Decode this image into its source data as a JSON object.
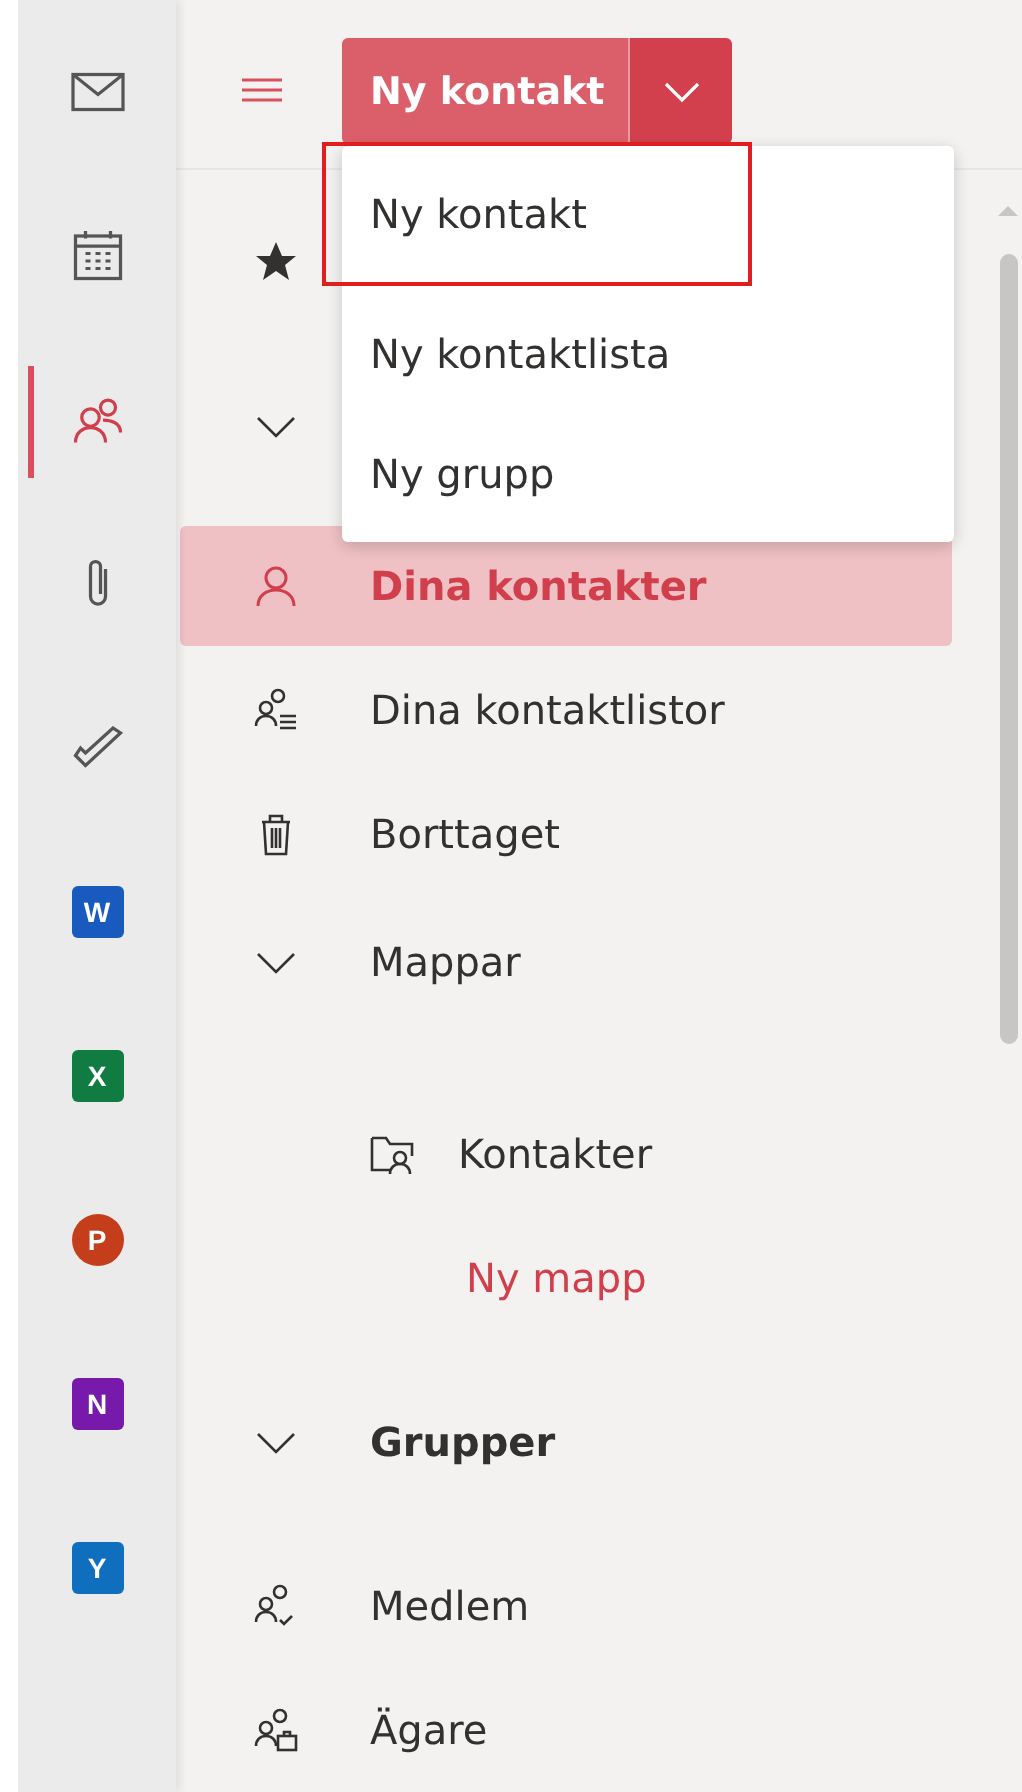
{
  "app_rail": [
    {
      "kind": "mail",
      "selected": false
    },
    {
      "kind": "calendar",
      "selected": false
    },
    {
      "kind": "people",
      "selected": true
    },
    {
      "kind": "files",
      "selected": false
    },
    {
      "kind": "todo",
      "selected": false
    },
    {
      "kind": "app",
      "letter": "W",
      "color": "#185abd",
      "selected": false
    },
    {
      "kind": "app",
      "letter": "X",
      "color": "#107c41",
      "selected": false
    },
    {
      "kind": "app-round",
      "letter": "P",
      "color": "#c43e1c",
      "selected": false
    },
    {
      "kind": "app",
      "letter": "N",
      "color": "#7719aa",
      "selected": false
    },
    {
      "kind": "app",
      "letter": "Y",
      "color": "#106ebe",
      "selected": false
    }
  ],
  "toolbar": {
    "new_button": {
      "label": "Ny kontakt"
    }
  },
  "new_menu": {
    "items": [
      {
        "label": "Ny kontakt",
        "highlighted": true
      },
      {
        "label": "Ny kontaktlista",
        "highlighted": false
      },
      {
        "label": "Ny grupp",
        "highlighted": false
      }
    ]
  },
  "nav": [
    {
      "kind": "favorites",
      "selected": false
    },
    {
      "kind": "section",
      "expanded": true
    },
    {
      "kind": "item",
      "label": "Dina kontakter",
      "selected": true
    },
    {
      "kind": "item",
      "label": "Dina kontaktlistor",
      "selected": false
    },
    {
      "kind": "item",
      "label": "Borttaget",
      "selected": false
    },
    {
      "kind": "section",
      "expanded": true,
      "label": "Mappar"
    },
    {
      "kind": "subitem",
      "label": "Kontakter",
      "selected": false
    },
    {
      "kind": "link",
      "label": "Ny mapp"
    },
    {
      "kind": "group",
      "expanded": true,
      "label": "Grupper"
    },
    {
      "kind": "item",
      "label": "Medlem",
      "selected": false
    },
    {
      "kind": "item",
      "label": "Ägare",
      "selected": false
    }
  ]
}
